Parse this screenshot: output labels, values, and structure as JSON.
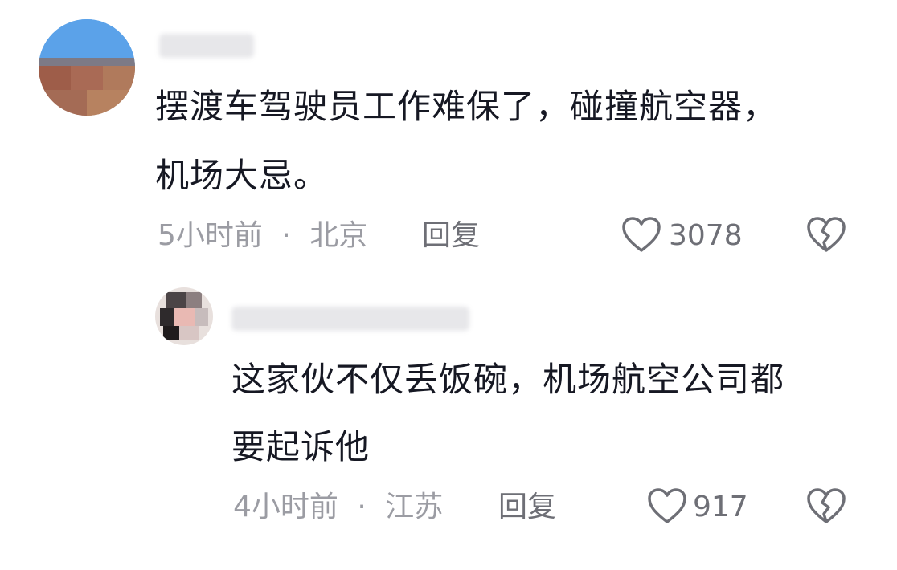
{
  "comments": [
    {
      "text_line1": "摆渡车驾驶员工作难保了，碰撞航空器，",
      "text_line2": "机场大忌。",
      "time": "5小时前",
      "location": "北京",
      "reply_label": "回复",
      "likes": "3078"
    },
    {
      "text_line1": "这家伙不仅丢饭碗，机场航空公司都",
      "text_line2": "要起诉他",
      "time": "4小时前",
      "location": "江苏",
      "reply_label": "回复",
      "likes": "917"
    }
  ],
  "separator": "·",
  "icons": {
    "like": "heart-outline-icon",
    "dislike": "broken-heart-icon"
  },
  "colors": {
    "text": "#161823",
    "meta": "#9b9ca3",
    "icon": "#6e6f76"
  }
}
